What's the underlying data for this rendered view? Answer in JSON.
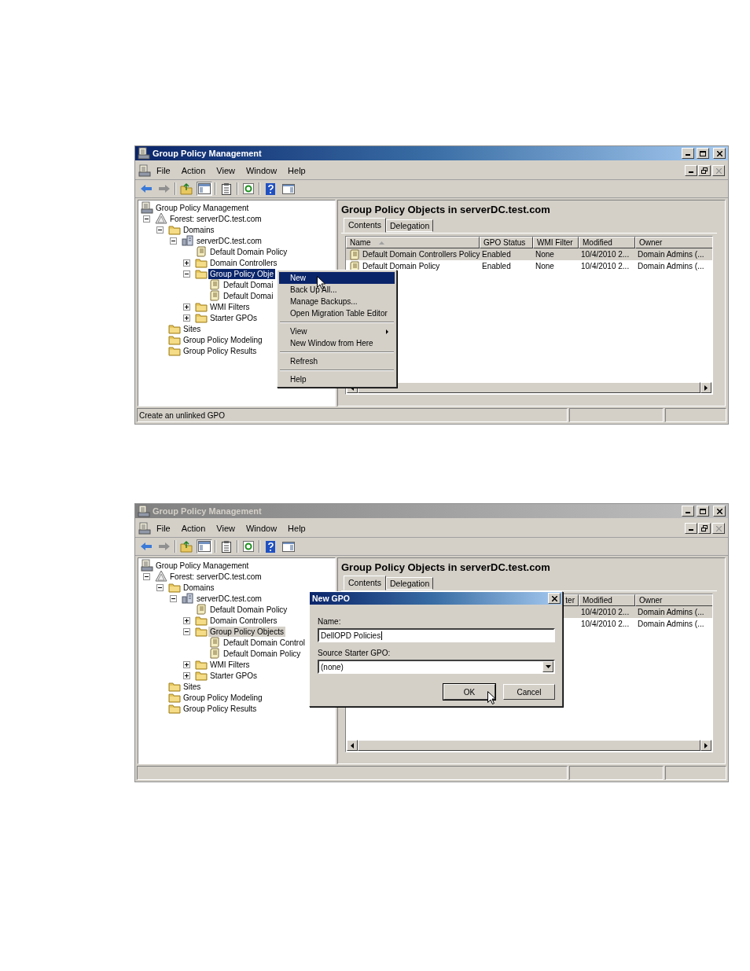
{
  "windows": [
    {
      "title": "Group Policy Management",
      "active": true,
      "menu_bar": [
        "File",
        "Action",
        "View",
        "Window",
        "Help"
      ],
      "tree": {
        "label": "Group Policy Management",
        "kind": "console",
        "selected": false,
        "children": [
          {
            "label": "Forest: serverDC.test.com",
            "kind": "forest",
            "selected": false,
            "expanded": true,
            "children": [
              {
                "label": "Domains",
                "kind": "folder",
                "selected": false,
                "expanded": true,
                "children": [
                  {
                    "label": "serverDC.test.com",
                    "kind": "domain",
                    "selected": false,
                    "expanded": true,
                    "children": [
                      {
                        "label": "Default Domain Policy",
                        "kind": "gpo",
                        "selected": false
                      },
                      {
                        "label": "Domain Controllers",
                        "kind": "folder",
                        "selected": false,
                        "expanded": false
                      },
                      {
                        "label": "Group Policy Obje",
                        "kind": "folder",
                        "selected": true,
                        "expanded": true,
                        "children": [
                          {
                            "label": "Default Domai",
                            "kind": "gpo",
                            "selected": false
                          },
                          {
                            "label": "Default Domai",
                            "kind": "gpo",
                            "selected": false
                          }
                        ]
                      },
                      {
                        "label": "WMI Filters",
                        "kind": "folder",
                        "selected": false,
                        "expanded": false
                      },
                      {
                        "label": "Starter GPOs",
                        "kind": "folder",
                        "selected": false,
                        "expanded": false
                      }
                    ]
                  }
                ]
              },
              {
                "label": "Sites",
                "kind": "folder",
                "selected": false
              },
              {
                "label": "Group Policy Modeling",
                "kind": "folder",
                "selected": false
              },
              {
                "label": "Group Policy Results",
                "kind": "folder",
                "selected": false
              }
            ]
          }
        ]
      },
      "pane": {
        "heading": "Group Policy Objects in serverDC.test.com",
        "tabs": [
          {
            "label": "Contents",
            "selected": true
          },
          {
            "label": "Delegation",
            "selected": false
          }
        ],
        "columns": [
          {
            "label": "Name",
            "sorted": true
          },
          {
            "label": "GPO Status"
          },
          {
            "label": "WMI Filter"
          },
          {
            "label": "Modified"
          },
          {
            "label": "Owner"
          }
        ],
        "rows": [
          {
            "selected": true,
            "cells": [
              "Default Domain Controllers Policy",
              "Enabled",
              "None",
              "10/4/2010 2...",
              "Domain Admins (..."
            ]
          },
          {
            "selected": false,
            "cells": [
              "Default Domain Policy",
              "Enabled",
              "None",
              "10/4/2010 2...",
              "Domain Admins (..."
            ]
          }
        ]
      },
      "status_bar": "Create an unlinked GPO",
      "context_menu": {
        "groups": [
          [
            {
              "label": "New",
              "selected": true
            },
            {
              "label": "Back Up All...",
              "selected": false
            },
            {
              "label": "Manage Backups...",
              "selected": false
            },
            {
              "label": "Open Migration Table Editor",
              "selected": false
            }
          ],
          [
            {
              "label": "View",
              "selected": false,
              "submenu": true
            },
            {
              "label": "New Window from Here",
              "selected": false
            }
          ],
          [
            {
              "label": "Refresh",
              "selected": false
            }
          ],
          [
            {
              "label": "Help",
              "selected": false
            }
          ]
        ]
      }
    },
    {
      "title": "Group Policy Management",
      "active": false,
      "menu_bar": [
        "File",
        "Action",
        "View",
        "Window",
        "Help"
      ],
      "tree": {
        "label": "Group Policy Management",
        "kind": "console",
        "selected": false,
        "children": [
          {
            "label": "Forest: serverDC.test.com",
            "kind": "forest",
            "selected": false,
            "expanded": true,
            "children": [
              {
                "label": "Domains",
                "kind": "folder",
                "selected": false,
                "expanded": true,
                "children": [
                  {
                    "label": "serverDC.test.com",
                    "kind": "domain",
                    "selected": false,
                    "expanded": true,
                    "children": [
                      {
                        "label": "Default Domain Policy",
                        "kind": "gpo",
                        "selected": false
                      },
                      {
                        "label": "Domain Controllers",
                        "kind": "folder",
                        "selected": false,
                        "expanded": false
                      },
                      {
                        "label": "Group Policy Objects",
                        "kind": "folder",
                        "selected": true,
                        "expanded": true,
                        "children": [
                          {
                            "label": "Default Domain Control",
                            "kind": "gpo",
                            "selected": false
                          },
                          {
                            "label": "Default Domain Policy",
                            "kind": "gpo",
                            "selected": false
                          }
                        ]
                      },
                      {
                        "label": "WMI Filters",
                        "kind": "folder",
                        "selected": false,
                        "expanded": false
                      },
                      {
                        "label": "Starter GPOs",
                        "kind": "folder",
                        "selected": false,
                        "expanded": false
                      }
                    ]
                  }
                ]
              },
              {
                "label": "Sites",
                "kind": "folder",
                "selected": false
              },
              {
                "label": "Group Policy Modeling",
                "kind": "folder",
                "selected": false
              },
              {
                "label": "Group Policy Results",
                "kind": "folder",
                "selected": false
              }
            ]
          }
        ]
      },
      "pane": {
        "heading": "Group Policy Objects in serverDC.test.com",
        "tabs": [
          {
            "label": "Contents",
            "selected": true
          },
          {
            "label": "Delegation",
            "selected": false
          }
        ],
        "columns": [
          {},
          {},
          {
            "label": "ter",
            "clipped": true
          },
          {
            "label": "Modified"
          },
          {
            "label": "Owner"
          }
        ],
        "rows": [
          {
            "selected": true,
            "cells": [
              null,
              null,
              null,
              "10/4/2010 2...",
              "Domain Admins (..."
            ]
          },
          {
            "selected": false,
            "cells": [
              null,
              null,
              null,
              "10/4/2010 2...",
              "Domain Admins (..."
            ]
          }
        ]
      },
      "dialog": {
        "title": "New GPO",
        "fields": [
          {
            "kind": "text",
            "label": "Name:",
            "value": "DellOPD Policies"
          },
          {
            "kind": "dropdown",
            "label": "Source Starter GPO:",
            "value": "(none)"
          }
        ],
        "buttons": [
          {
            "label": "OK",
            "default": true
          },
          {
            "label": "Cancel",
            "default": false
          }
        ]
      }
    }
  ]
}
